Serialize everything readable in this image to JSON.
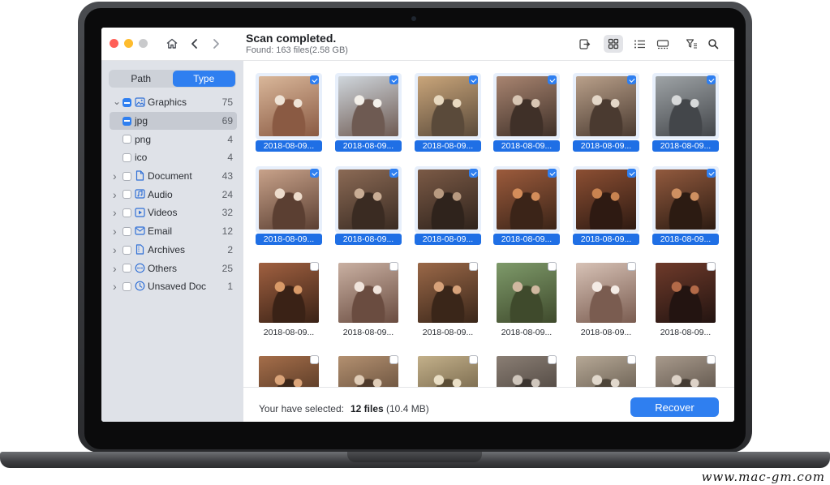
{
  "window": {
    "title": "Scan completed.",
    "subtitle": "Found: 163 files(2.58 GB)"
  },
  "toolbar": {
    "icons": [
      "export-icon",
      "grid-view-icon",
      "list-view-icon",
      "preview-view-icon",
      "filter-icon",
      "search-icon"
    ],
    "active_view": "grid"
  },
  "sidebar": {
    "tabs": [
      {
        "label": "Path",
        "active": false
      },
      {
        "label": "Type",
        "active": true
      }
    ],
    "items": [
      {
        "label": "Graphics",
        "count": "75",
        "icon": "image-icon",
        "expanded": true,
        "check": "mixed"
      },
      {
        "label": "jpg",
        "count": "69",
        "child": true,
        "selected": true,
        "check": "mixed"
      },
      {
        "label": "png",
        "count": "4",
        "child": true,
        "check": "off"
      },
      {
        "label": "ico",
        "count": "4",
        "child": true,
        "check": "off"
      },
      {
        "label": "Document",
        "count": "43",
        "icon": "document-icon",
        "check": "off"
      },
      {
        "label": "Audio",
        "count": "24",
        "icon": "audio-icon",
        "check": "off"
      },
      {
        "label": "Videos",
        "count": "32",
        "icon": "video-icon",
        "check": "off"
      },
      {
        "label": "Email",
        "count": "12",
        "icon": "mail-icon",
        "check": "off"
      },
      {
        "label": "Archives",
        "count": "2",
        "icon": "archive-icon",
        "check": "off"
      },
      {
        "label": "Others",
        "count": "25",
        "icon": "others-icon",
        "check": "off"
      },
      {
        "label": "Unsaved Doc",
        "count": "1",
        "icon": "clock-icon",
        "check": "off"
      }
    ]
  },
  "files": [
    {
      "name": "2018-08-09...",
      "checked": true
    },
    {
      "name": "2018-08-09...",
      "checked": true
    },
    {
      "name": "2018-08-09...",
      "checked": true
    },
    {
      "name": "2018-08-09...",
      "checked": true
    },
    {
      "name": "2018-08-09...",
      "checked": true
    },
    {
      "name": "2018-08-09...",
      "checked": true
    },
    {
      "name": "2018-08-09...",
      "checked": true
    },
    {
      "name": "2018-08-09...",
      "checked": true
    },
    {
      "name": "2018-08-09...",
      "checked": true
    },
    {
      "name": "2018-08-09...",
      "checked": true
    },
    {
      "name": "2018-08-09...",
      "checked": true
    },
    {
      "name": "2018-08-09...",
      "checked": true
    },
    {
      "name": "2018-08-09...",
      "checked": false
    },
    {
      "name": "2018-08-09...",
      "checked": false
    },
    {
      "name": "2018-08-09...",
      "checked": false
    },
    {
      "name": "2018-08-09...",
      "checked": false
    },
    {
      "name": "2018-08-09...",
      "checked": false
    },
    {
      "name": "2018-08-09...",
      "checked": false
    },
    {
      "name": "",
      "checked": false
    },
    {
      "name": "",
      "checked": false
    },
    {
      "name": "",
      "checked": false
    },
    {
      "name": "",
      "checked": false
    },
    {
      "name": "",
      "checked": false
    },
    {
      "name": "",
      "checked": false
    }
  ],
  "footer": {
    "label": "Your have selected:",
    "count": "12 files",
    "size": "(10.4 MB)",
    "recover_label": "Recover"
  },
  "watermark": "www.mac-gm.com",
  "colors": {
    "accent": "#2f7ff0",
    "selection_caption": "#1f6fe5",
    "sidebar_bg": "#dfe2e8"
  }
}
